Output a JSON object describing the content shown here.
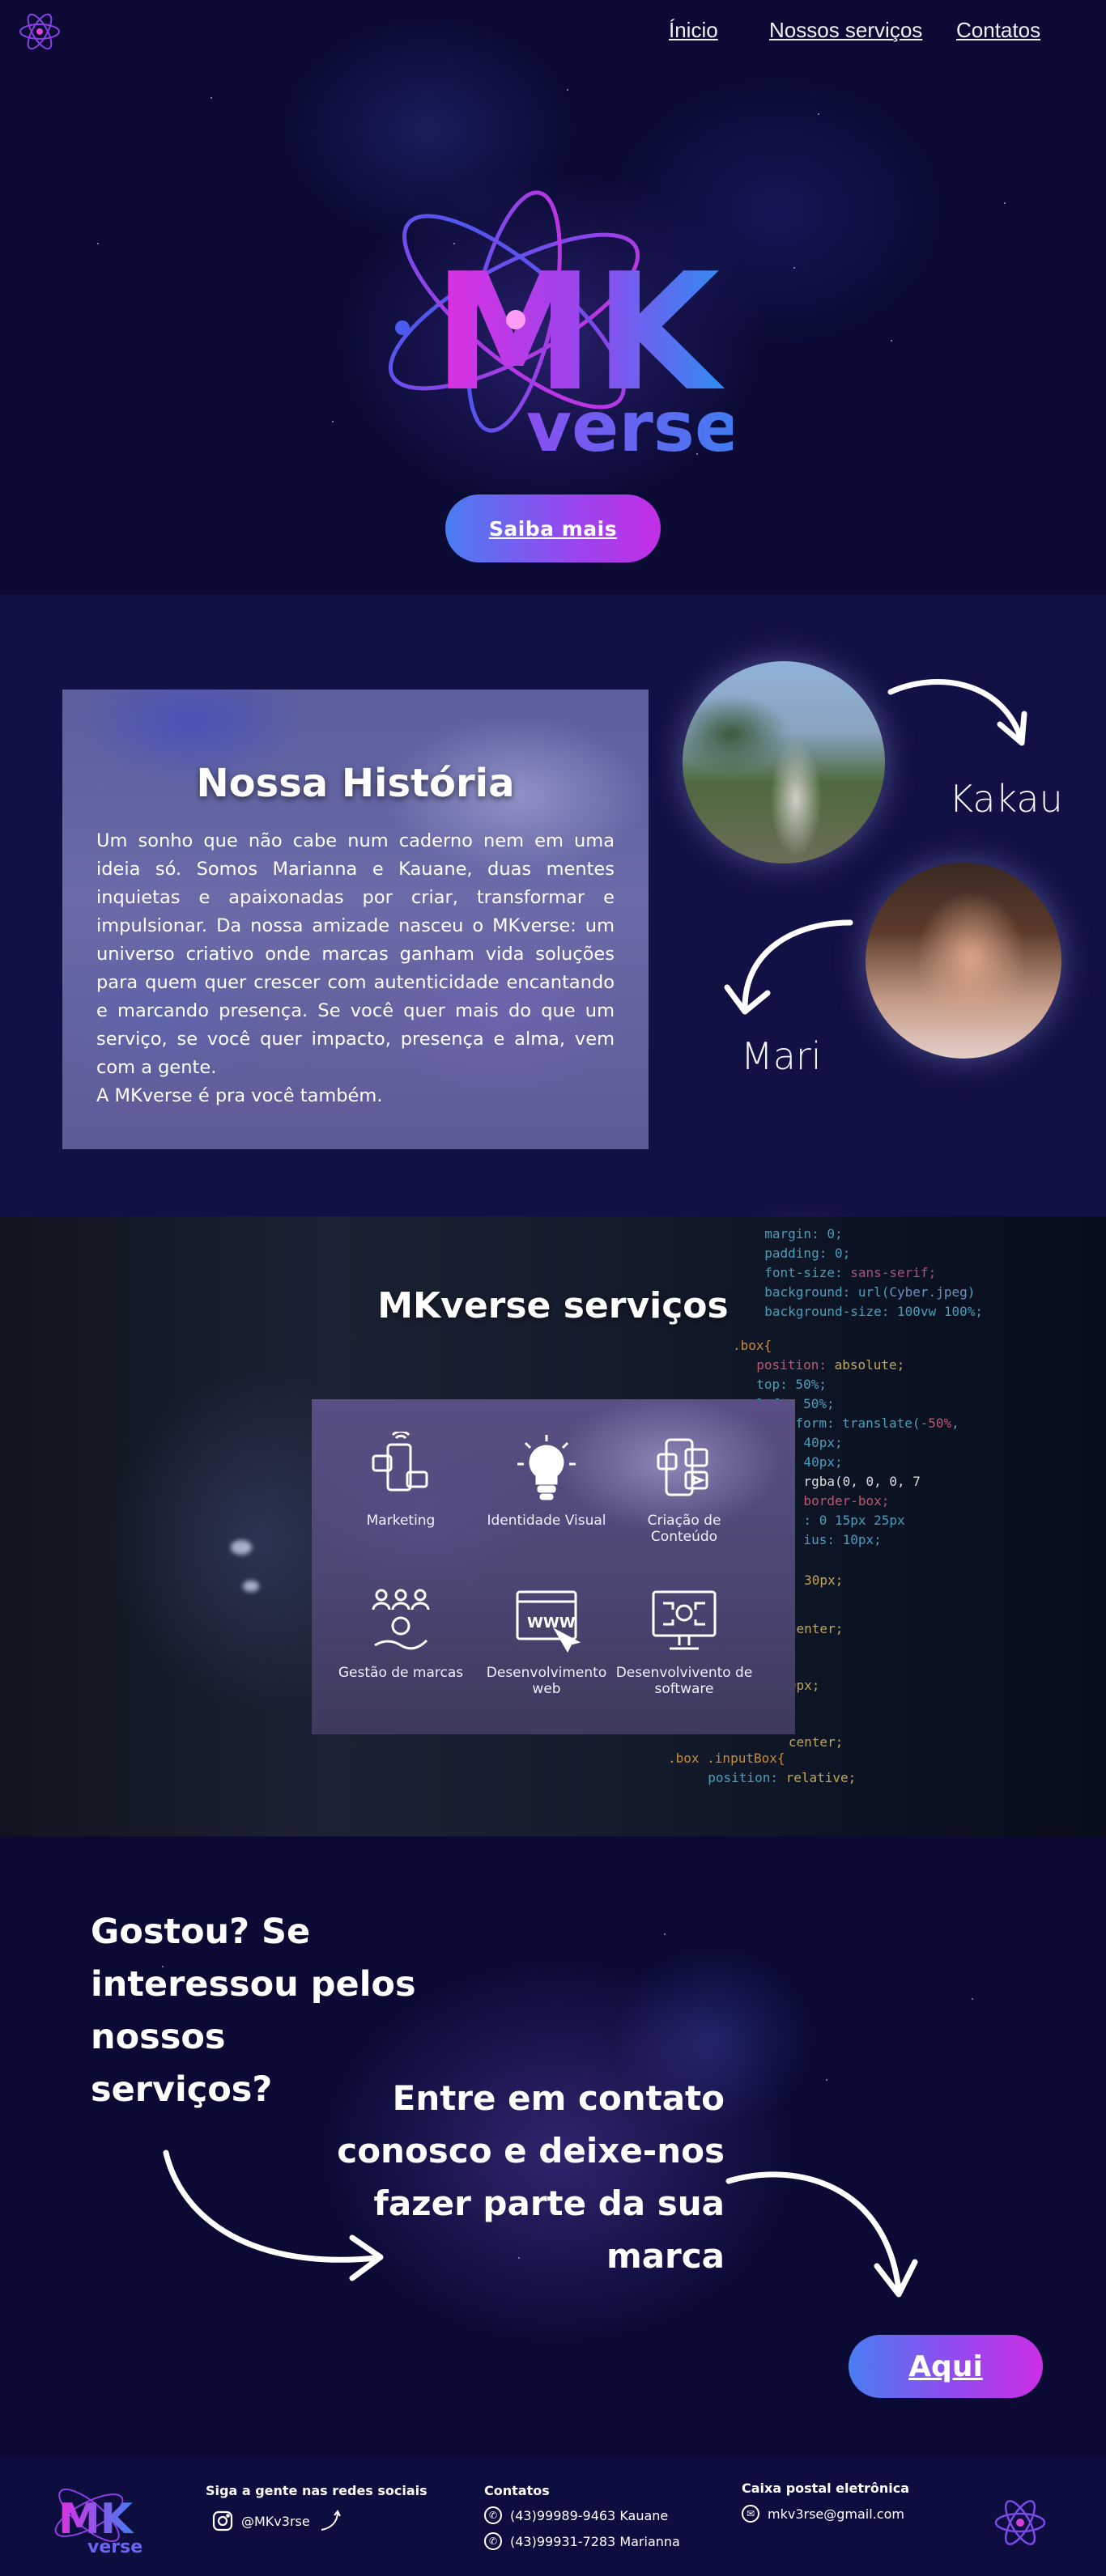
{
  "nav": {
    "links": [
      {
        "label": "Ínicio"
      },
      {
        "label": "Nossos serviços"
      },
      {
        "label": "Contatos"
      }
    ]
  },
  "hero": {
    "logo_mk": "MK",
    "logo_verse": "verse",
    "cta_label": "Saiba mais"
  },
  "history": {
    "title": "Nossa História",
    "text": " Um sonho que não cabe num caderno nem em uma ideia só. Somos Marianna e Kauane, duas mentes inquietas e apaixonadas por criar, transformar e impulsionar. Da nossa amizade nasceu o MKverse: um universo criativo onde marcas ganham vida soluções para quem quer crescer com autenticidade encantando e marcando presença. Se você quer mais do que um serviço, se você quer impacto, presença e alma, vem com a gente.\n A MKverse é pra você também.",
    "people": [
      {
        "name": "Kakau"
      },
      {
        "name": "Mari"
      }
    ]
  },
  "services": {
    "title_bold": "MKverse",
    "title_rest": " serviços",
    "items": [
      {
        "label": "Marketing",
        "icon": "social-phone-icon"
      },
      {
        "label": "Identidade Visual",
        "icon": "lightbulb-icon"
      },
      {
        "label": "Criação de Conteúdo",
        "icon": "content-phone-icon"
      },
      {
        "label": "Gestão de marcas",
        "icon": "brand-management-icon"
      },
      {
        "label": "Desenvolvimento web",
        "icon": "www-browser-icon"
      },
      {
        "label": "Desenvolvivento de software",
        "icon": "software-monitor-icon"
      }
    ]
  },
  "contact_cta": {
    "left_text": "Gostou? Se\ninteressou pelos\nnossos\nserviços?",
    "right_text": "Entre em contato\nconosco e deixe-nos\nfazer parte da sua\nmarca",
    "button_label": "Aqui"
  },
  "footer": {
    "social_heading": "Siga a gente nas redes sociais",
    "instagram": "@MKv3rse",
    "contacts_heading": "Contatos",
    "phone_1": "(43)99989-9463 Kauane",
    "phone_2": "(43)99931-7283 Marianna",
    "email_heading": "Caixa postal eletrônica",
    "email": "mkv3rse@gmail.com"
  },
  "colors": {
    "background": "#0a0a35",
    "accent_blue": "#4a7df2",
    "accent_magenta": "#c32ee6"
  }
}
